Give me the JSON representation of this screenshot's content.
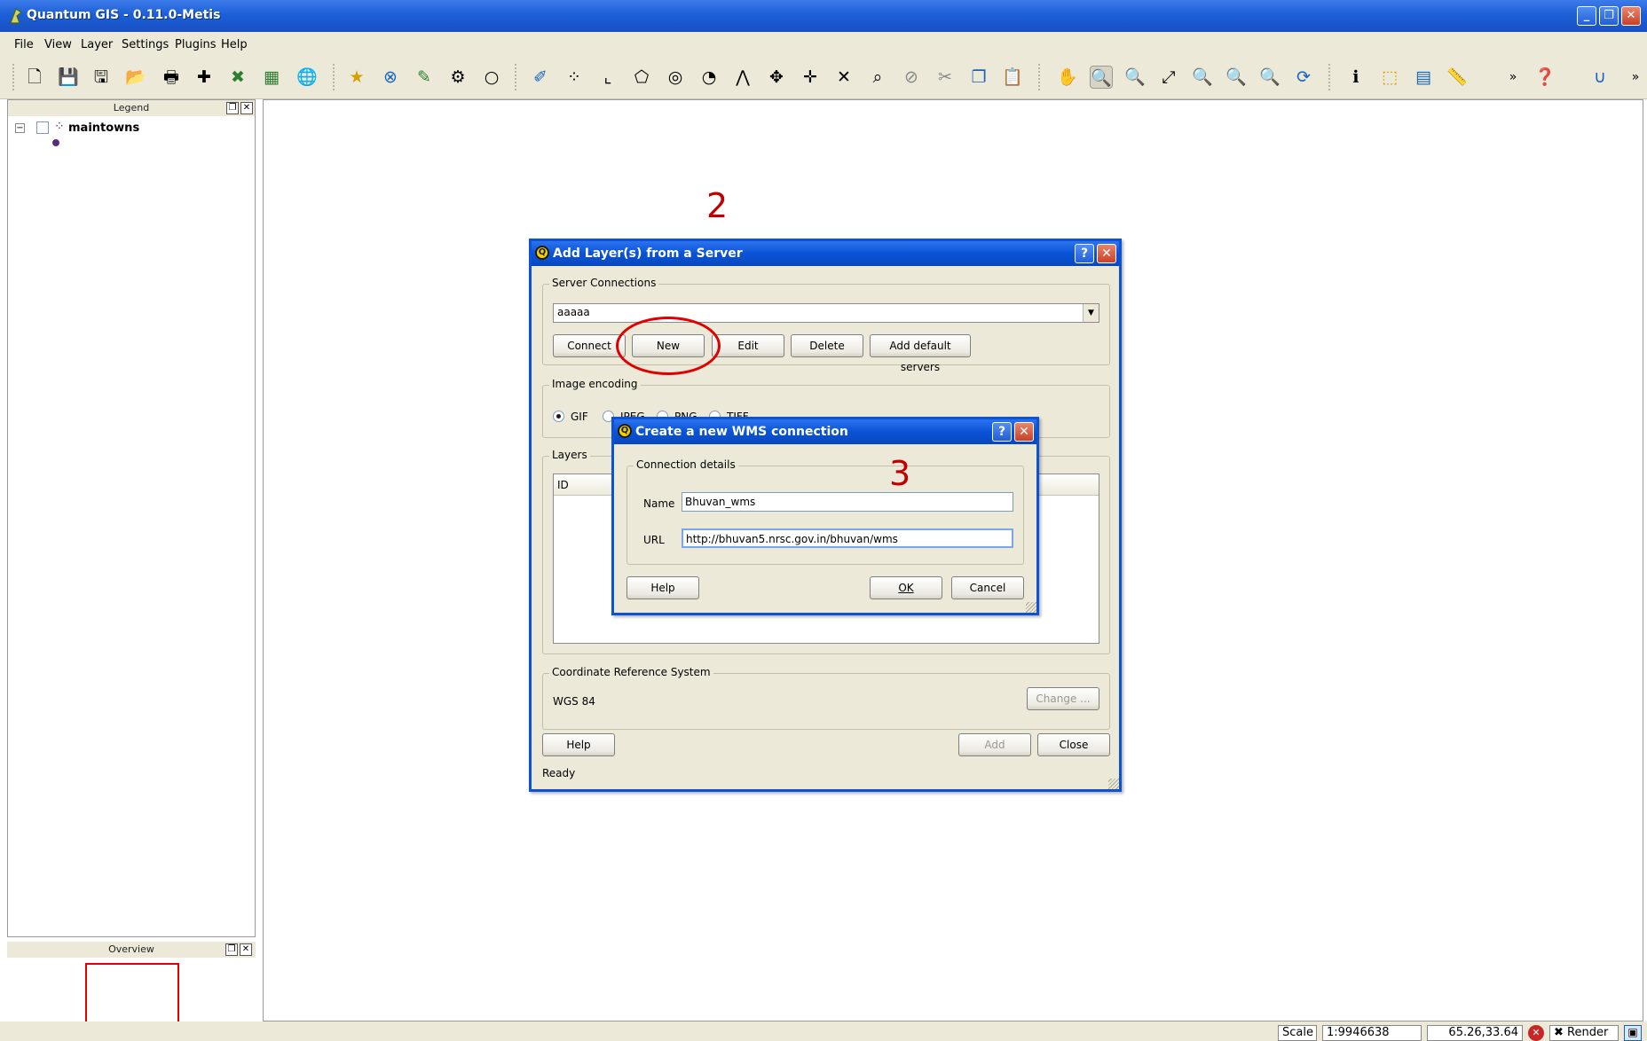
{
  "window": {
    "title": "Quantum GIS - 0.11.0-Metis",
    "controls": [
      "minimize-icon",
      "restore-icon",
      "close-icon"
    ]
  },
  "menu": [
    "File",
    "View",
    "Layer",
    "Settings",
    "Plugins",
    "Help"
  ],
  "toolbar": {
    "icons": [
      "new-project-icon",
      "save-icon",
      "save-as-icon",
      "open-icon",
      "print-icon",
      "add-vector-icon",
      "remove-layer-icon",
      "add-raster-icon",
      "add-wms-icon",
      "new-layer-icon",
      "delete-icon",
      "edit-icon",
      "settings-icon",
      "lens-icon",
      "pencil-icon",
      "capture-point-icon",
      "capture-line-icon",
      "capture-polygon-icon",
      "add-ring-icon",
      "add-island-icon",
      "split-icon",
      "move-vertex-icon",
      "add-vertex-icon",
      "delete-vertex-icon",
      "cut-icon",
      "delete-feature-icon",
      "cut-feature-icon",
      "copy-icon",
      "paste-icon",
      "pan-icon",
      "zoom-in-icon",
      "zoom-out-icon",
      "zoom-full-icon",
      "zoom-layer-icon",
      "zoom-select-icon",
      "zoom-last-icon",
      "refresh-icon",
      "identify-icon",
      "select-icon",
      "attribute-table-icon",
      "measure-icon"
    ],
    "overflow_label": "»"
  },
  "legend": {
    "header": "Legend",
    "layers": [
      {
        "name": "maintowns",
        "checked": false
      }
    ]
  },
  "overview": {
    "header": "Overview"
  },
  "status": {
    "scale_label": "Scale",
    "scale_value": "1:9946638",
    "coords": "65.26,33.64",
    "render_label": "Render"
  },
  "add_layer_dialog": {
    "title": "Add Layer(s) from a Server",
    "server_connections_label": "Server Connections",
    "selected_server": "aaaaa",
    "buttons": {
      "connect": "Connect",
      "new": "New",
      "edit": "Edit",
      "delete": "Delete",
      "add_default": "Add default servers"
    },
    "image_encoding_label": "Image encoding",
    "encodings": [
      "GIF",
      "JPEG",
      "PNG",
      "TIFF"
    ],
    "selected_encoding": "GIF",
    "layers_label": "Layers",
    "layers_column": "ID",
    "crs_label": "Coordinate Reference System",
    "crs_value": "WGS 84",
    "change_label": "Change ...",
    "help_label": "Help",
    "add_label": "Add",
    "close_label": "Close",
    "status_text": "Ready"
  },
  "new_wms_dialog": {
    "title": "Create a new WMS connection",
    "group_label": "Connection details",
    "name_label": "Name",
    "name_value": "Bhuvan_wms",
    "url_label": "URL",
    "url_value": "http://bhuvan5.nrsc.gov.in/bhuvan/wms",
    "help_label": "Help",
    "ok_label": "OK",
    "cancel_label": "Cancel"
  },
  "annotations": {
    "step2": "2",
    "step3": "3"
  },
  "colors": {
    "title_blue": "#0a53d6",
    "window_face": "#ece9d8",
    "annotation_red": "#c00000"
  }
}
